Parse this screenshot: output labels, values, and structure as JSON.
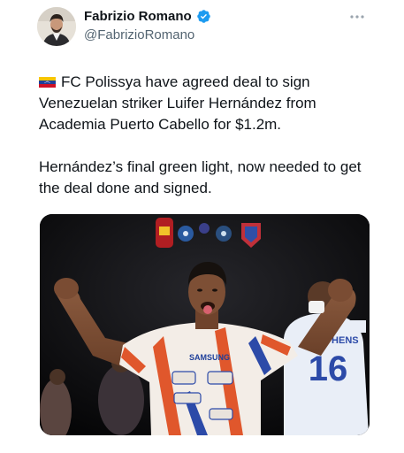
{
  "author": {
    "name": "Fabrizio Romano",
    "handle": "@FabrizioRomano",
    "verified": true,
    "avatar_icon": "profile-photo"
  },
  "tweet": {
    "flag": "venezuela-flag-icon",
    "line1": "FC Polissya have agreed deal to sign Venezuelan striker Luifer Hernández from Academia Puerto Cabello for $1.2m.",
    "line2": "Hernández’s final green light, now needed to get the deal done and signed."
  },
  "media": {
    "description_icon": "football-celebration-photo",
    "sponsor_text": "SAMSUNG",
    "back_name": "EPHENS",
    "back_number": "16"
  },
  "colors": {
    "text": "#0f1419",
    "secondary": "#536471",
    "verified": "#1d9bf0"
  }
}
